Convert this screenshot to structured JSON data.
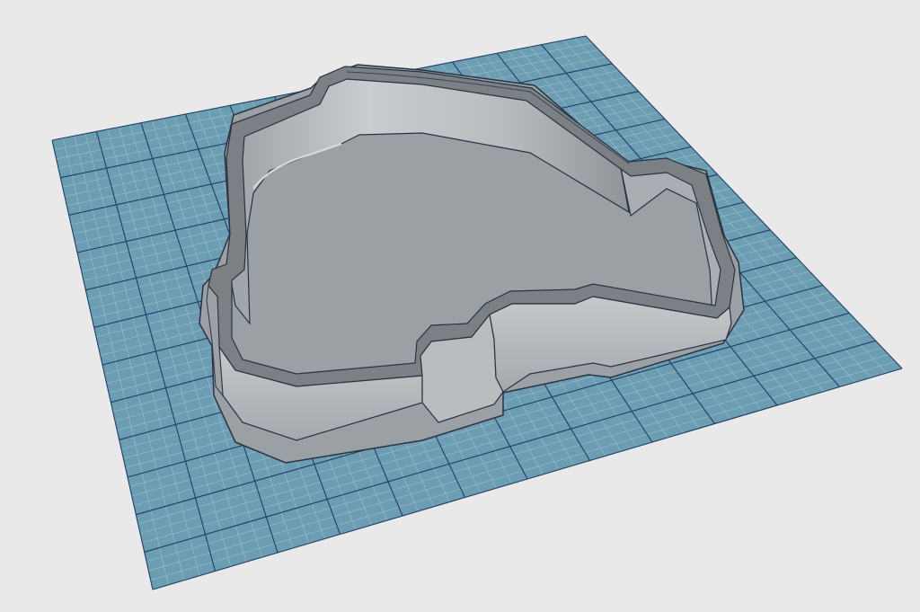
{
  "scene": {
    "background_color": "#e9e9e9",
    "grid": {
      "plane_color": "#6c9db2",
      "major_line_color": "#1f3f66",
      "minor_line_color": "#9cc0cf",
      "major_divisions": 12,
      "minor_per_major": 4
    },
    "model": {
      "name_icon": "cookie-cutter-model",
      "wall_color": "#b4b8bb",
      "wall_shadow_color": "#8e9397",
      "rim_color": "#7d8186",
      "edge_color": "#2a3344"
    }
  }
}
